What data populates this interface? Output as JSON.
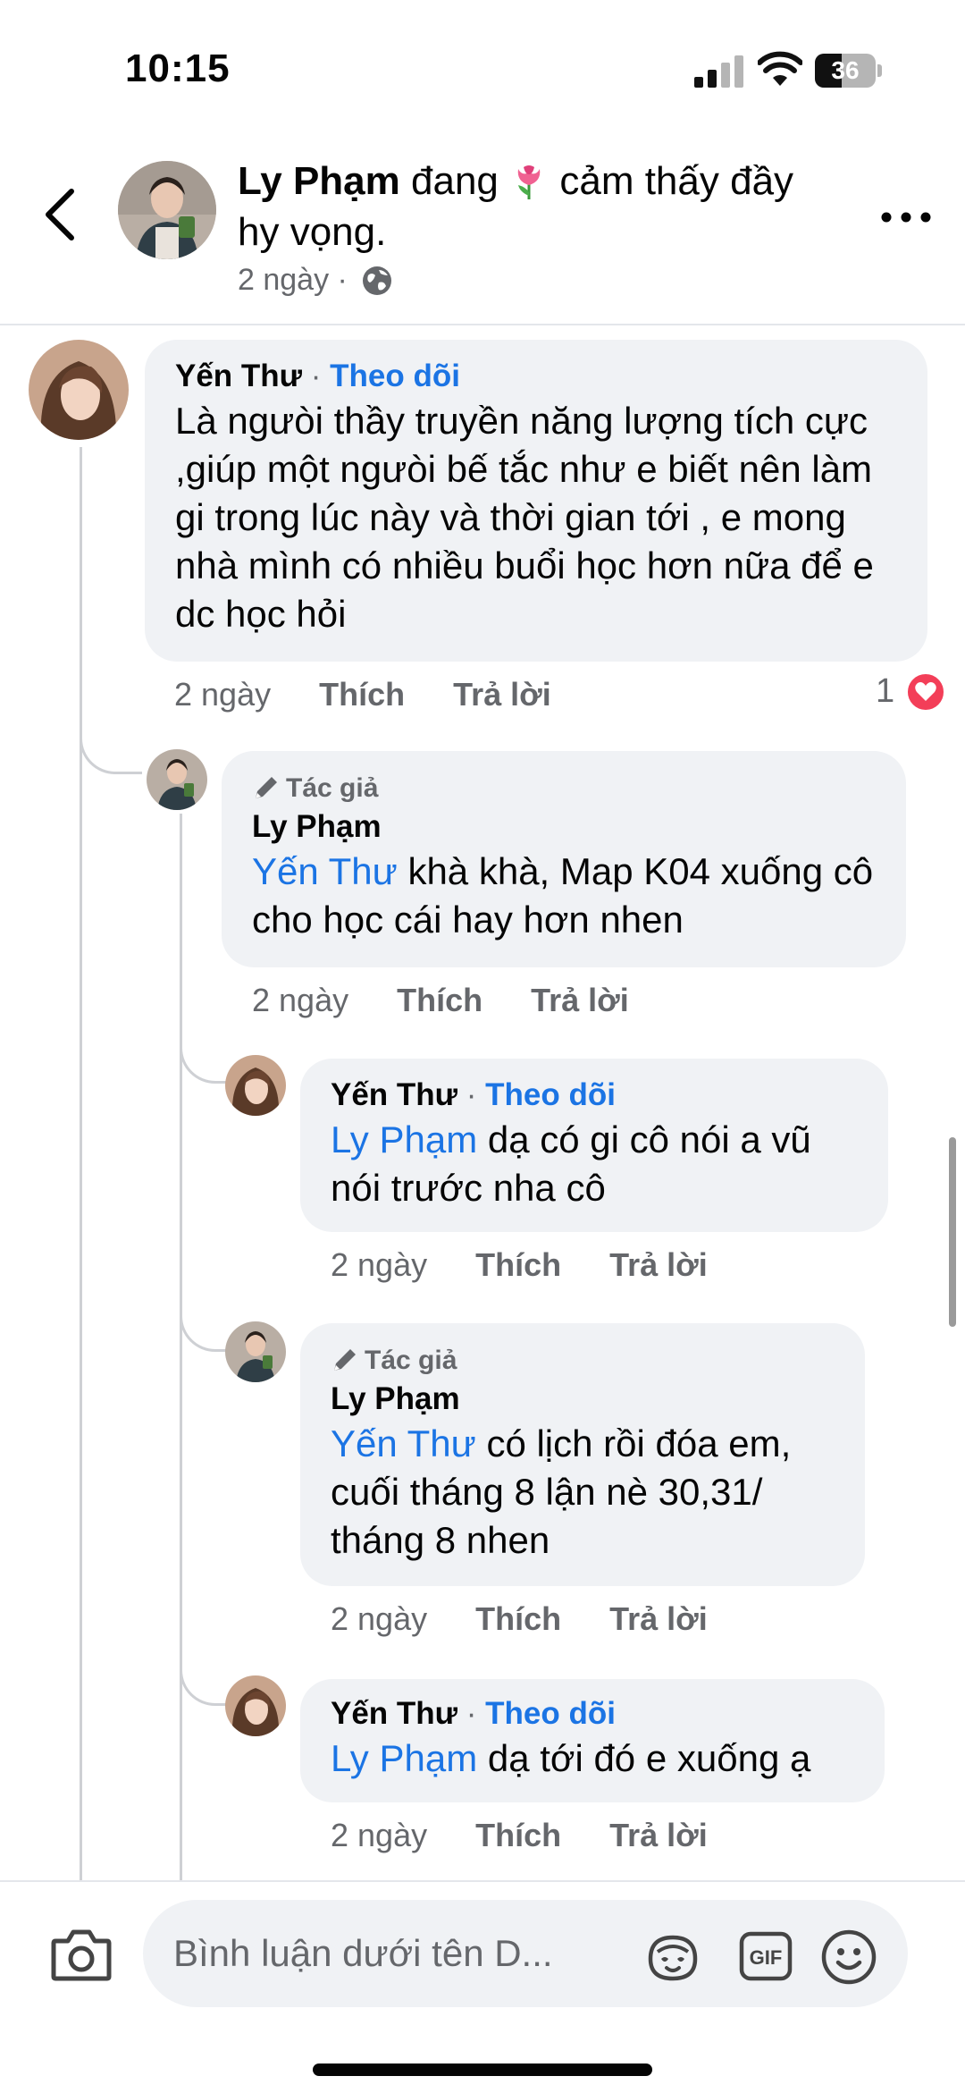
{
  "status": {
    "time": "10:15",
    "battery": "36"
  },
  "post": {
    "author": "Ly Phạm",
    "feeling_pre": "đang",
    "feeling_post": "cảm thấy đầy hy vọng.",
    "time": "2 ngày",
    "separator": "·"
  },
  "comments": [
    {
      "name": "Yến Thư",
      "dot": "·",
      "follow": "Theo dõi",
      "text": "Là ngưòi thầy truyền năng lượng tích cực ,giúp một ngưòi bế tắc như e biết nên làm gi trong lúc này và thời gian tới , e mong nhà mình có nhiều buổi học hơn nữa để e dc học hỏi",
      "time": "2 ngày",
      "like": "Thích",
      "reply": "Trả lời",
      "reaction_count": "1"
    },
    {
      "badge": "Tác giả",
      "name": "Ly Phạm",
      "mention": "Yến Thư",
      "text": " khà khà, Map K04 xuống cô cho học cái hay hơn nhen",
      "time": "2 ngày",
      "like": "Thích",
      "reply": "Trả lời"
    },
    {
      "name": "Yến Thư",
      "dot": "·",
      "follow": "Theo dõi",
      "mention": "Ly Phạm",
      "text": " dạ có gi cô nói a vũ nói trước nha cô",
      "time": "2 ngày",
      "like": "Thích",
      "reply": "Trả lời"
    },
    {
      "badge": "Tác giả",
      "name": "Ly Phạm",
      "mention": "Yến Thư",
      "text": " có lịch rồi đóa em, cuối tháng 8 lận nè 30,31/ tháng 8 nhen",
      "time": "2 ngày",
      "like": "Thích",
      "reply": "Trả lời"
    },
    {
      "name": "Yến Thư",
      "dot": "·",
      "follow": "Theo dõi",
      "mention": "Ly Phạm",
      "text": " dạ tới đó e xuống ạ",
      "time": "2 ngày",
      "like": "Thích",
      "reply": "Trả lời"
    }
  ],
  "composer": {
    "placeholder": "Bình luận dưới tên D..."
  },
  "icons": {
    "back": "chevron-left-icon",
    "more": "more-horizontal-icon",
    "globe": "globe-icon",
    "camera": "camera-icon",
    "gif": "gif-icon",
    "emoji": "emoji-icon",
    "avatar_sticker": "avatar-sticker-icon",
    "heart": "heart-icon",
    "author_pen": "pen-icon"
  },
  "colors": {
    "link": "#1b74e4",
    "bubble": "#f0f2f5",
    "muted": "#65676b",
    "heart": "#f33e58"
  }
}
